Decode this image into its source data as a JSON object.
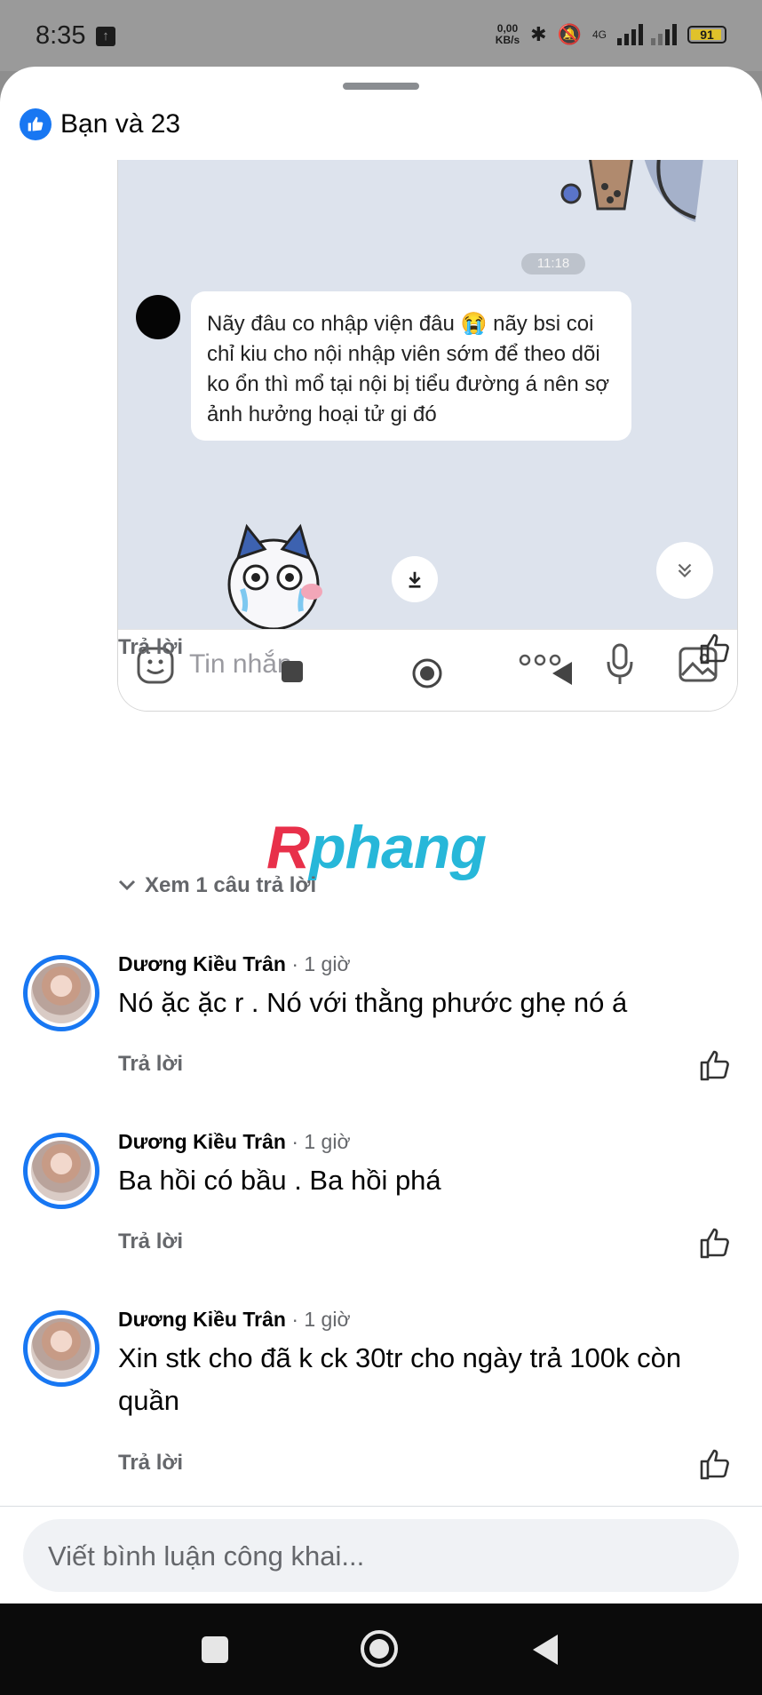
{
  "status_bar": {
    "time": "8:35",
    "net_speed": "0,00",
    "net_speed_unit": "KB/s",
    "network": "4G",
    "battery": "91"
  },
  "sheet": {
    "reactions_label": "Bạn và 23"
  },
  "screenshot": {
    "time_badge": "11:18",
    "message": "Nãy đâu co nhập viện đâu 😭 nãy bsi coi chỉ kiu cho nội nhập viên sớm để theo dõi ko ổn thì mổ tại nội bị tiểu đường á nên sợ ảnh hưởng hoại tử gi đó",
    "input_placeholder": "Tin nhắn"
  },
  "first_comment": {
    "reply_label": "Trả lời",
    "view_replies": "Xem 1 câu trả lời"
  },
  "watermark": {
    "first": "R",
    "rest": "phang"
  },
  "comments": [
    {
      "author": "Dương Kiều Trân",
      "time": "· 1 giờ",
      "text": "Nó ặc ặc r . Nó với thằng phước ghẹ nó á",
      "reply_label": "Trả lời"
    },
    {
      "author": "Dương Kiều Trân",
      "time": "· 1 giờ",
      "text": "Ba hồi có bầu . Ba hồi phá",
      "reply_label": "Trả lời"
    },
    {
      "author": "Dương Kiều Trân",
      "time": "· 1 giờ",
      "text": "Xin stk cho đã k ck 30tr cho ngày trả 100k còn quần",
      "reply_label": "Trả lời"
    }
  ],
  "composer": {
    "placeholder": "Viết bình luận công khai..."
  },
  "colors": {
    "accent": "#1877f2",
    "muted_text": "#65676b",
    "watermark_red": "#e8304a",
    "watermark_blue": "#27b7d9"
  }
}
